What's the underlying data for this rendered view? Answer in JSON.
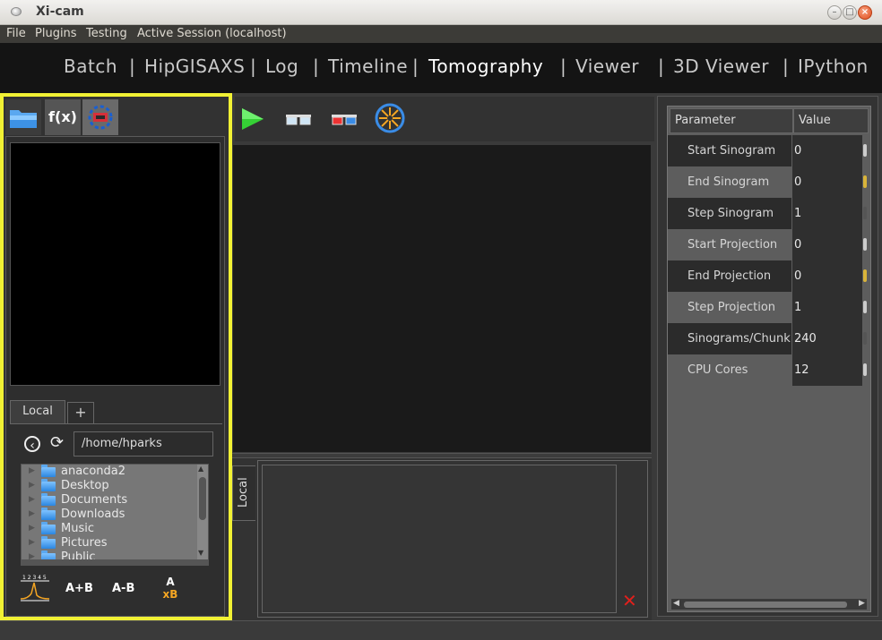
{
  "window": {
    "title": "Xi-cam"
  },
  "menu": {
    "file": "File",
    "plugins": "Plugins",
    "testing": "Testing",
    "session": "Active Session (localhost)"
  },
  "plugins": {
    "items": [
      "Batch",
      "HipGISAXS",
      "Log",
      "Timeline",
      "Tomography",
      "Viewer",
      "3D Viewer",
      "IPython"
    ],
    "separator": "|",
    "active": "Tomography"
  },
  "left_panel": {
    "tabs": {
      "files_icon": "folder-icon",
      "functions": "f(x)",
      "roi_icon": "target-icon"
    },
    "file_tabs": {
      "local": "Local",
      "add": "+"
    },
    "path": "/home/hparks",
    "files": [
      "anaconda2",
      "Desktop",
      "Documents",
      "Downloads",
      "Music",
      "Pictures",
      "Public"
    ],
    "tools": {
      "a_plus_b": "A+B",
      "a_minus_b": "A-B",
      "a_times_b_top": "A",
      "a_times_b_bottom": "xB"
    }
  },
  "center": {
    "toolbar": [
      "run-icon",
      "preview-glasses-icon",
      "3d-glasses-icon",
      "center-of-rotation-icon"
    ],
    "bottom_tab": "Local",
    "close_label": "✕"
  },
  "parameters": {
    "header": {
      "param": "Parameter",
      "value": "Value"
    },
    "rows": [
      {
        "name": "Start Sinogram",
        "value": "0"
      },
      {
        "name": "End Sinogram",
        "value": "0"
      },
      {
        "name": "Step Sinogram",
        "value": "1"
      },
      {
        "name": "Start Projection",
        "value": "0"
      },
      {
        "name": "End Projection",
        "value": "0"
      },
      {
        "name": "Step Projection",
        "value": "1"
      },
      {
        "name": "Sinograms/Chunk",
        "value": "240"
      },
      {
        "name": "CPU Cores",
        "value": "12"
      }
    ]
  },
  "colors": {
    "highlight_border": "#f1f134",
    "run_green": "#35d135",
    "close_red": "#e0201c"
  }
}
